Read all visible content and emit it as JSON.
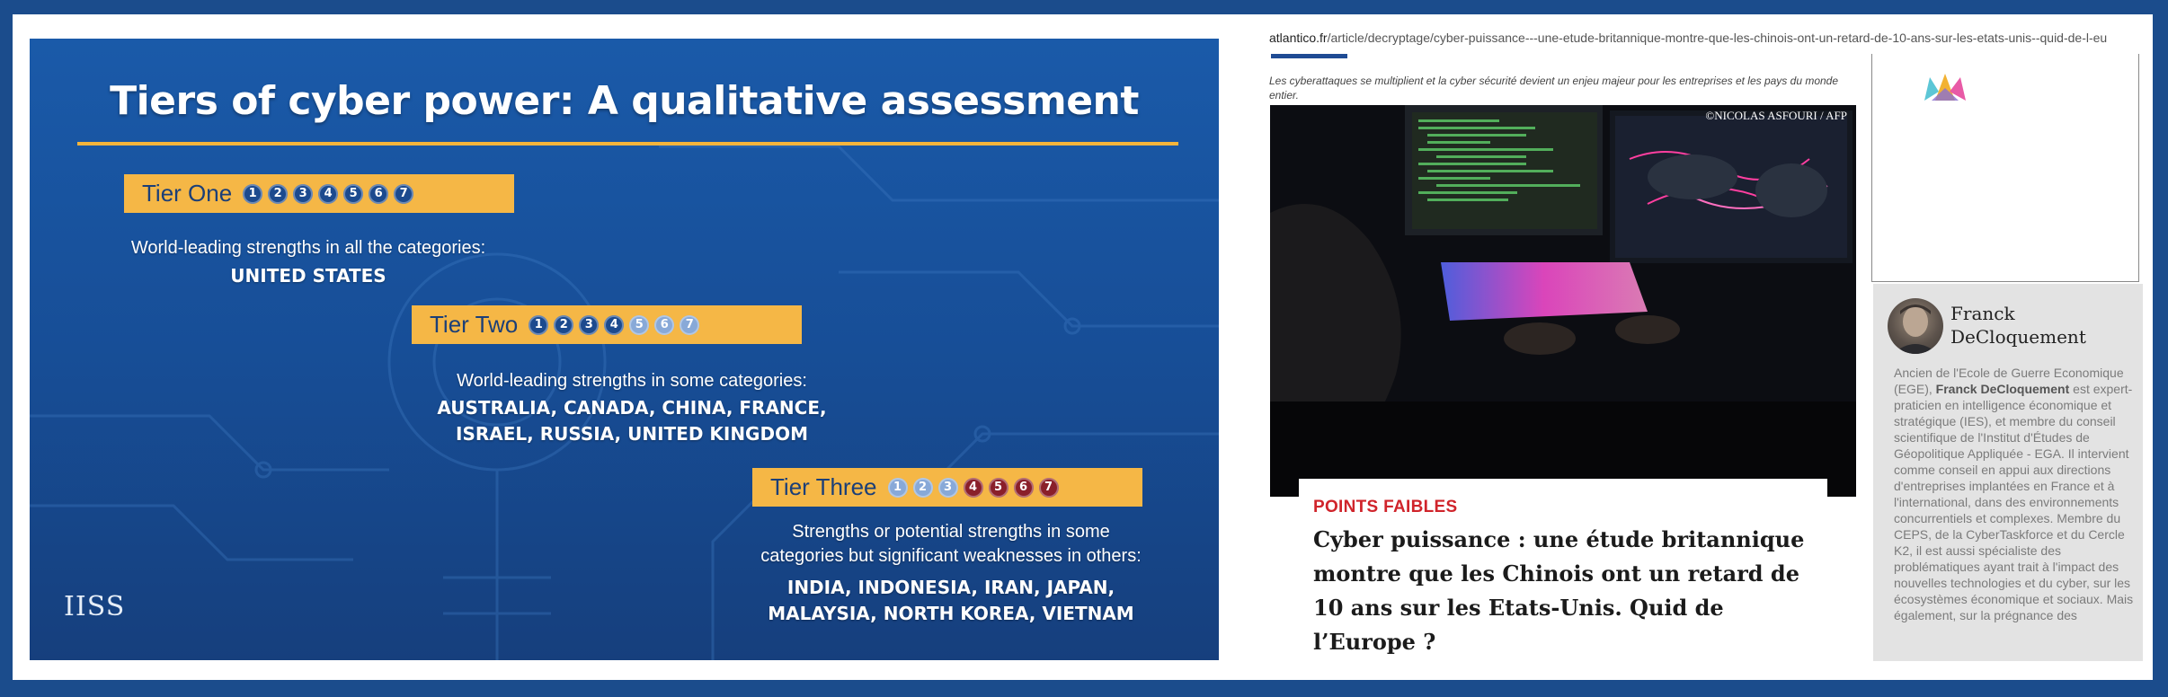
{
  "slide": {
    "title": "Tiers of cyber power: A qualitative assessment",
    "tiers": [
      {
        "label": "Tier One",
        "dots": [
          "1",
          "2",
          "3",
          "4",
          "5",
          "6",
          "7"
        ],
        "description": "World-leading strengths in all the categories:",
        "countries_line1": "UNITED STATES",
        "countries_line2": ""
      },
      {
        "label": "Tier Two",
        "dots": [
          "1",
          "2",
          "3",
          "4",
          "5",
          "6",
          "7"
        ],
        "description": "World-leading strengths in some categories:",
        "countries_line1": "AUSTRALIA, CANADA, CHINA, FRANCE,",
        "countries_line2": "ISRAEL, RUSSIA, UNITED KINGDOM"
      },
      {
        "label": "Tier Three",
        "dots": [
          "1",
          "2",
          "3",
          "4",
          "5",
          "6",
          "7"
        ],
        "description_line1": "Strengths or potential strengths in some",
        "description_line2": "categories but significant weaknesses in others:",
        "countries_line1": "INDIA, INDONESIA, IRAN, JAPAN,",
        "countries_line2": "MALAYSIA, NORTH KOREA, VIETNAM"
      }
    ],
    "colors": {
      "strength": "#1c4a8e",
      "partial": "#88a9d8",
      "weakness": "#8a1f2a",
      "tier_bar": "#f5b746"
    },
    "logo_text": "IISS"
  },
  "article": {
    "url_domain": "atlantico.fr",
    "url_path": "/article/decryptage/cyber-puissance---une-etude-britannique-montre-que-les-chinois-ont-un-retard-de-10-ans-sur-les-etats-unis--quid-de-l-eu",
    "caption": "Les cyberattaques se multiplient et la cyber sécurité devient un enjeu majeur pour les entreprises et les pays du monde entier.",
    "photo_credit": "©NICOLAS ASFOURI / AFP",
    "kicker": "POINTS FAIBLES",
    "headline": "Cyber puissance : une étude britannique montre que les Chinois ont un retard de 10 ans sur les Etats-Unis. Quid de l’Europe ?",
    "kicker_color": "#d0242b"
  },
  "author": {
    "name_line1": "Franck",
    "name_line2": "DeCloquement",
    "bio_intro": "Ancien de l'Ecole de Guerre Economique (EGE), ",
    "bio_name": "Franck DeCloquement",
    "bio_rest": " est expert-praticien en intelligence économique et stratégique (IES), et membre du conseil scientifique de l'Institut d'Études de Géopolitique Appliquée - EGA. Il intervient comme conseil en appui aux directions d'entreprises implantées en France et à l'international, dans des environnements concurrentiels et complexes. Membre du CEPS, de la CyberTaskforce et du Cercle K2, il est aussi spécialiste des problématiques ayant trait à l'impact des nouvelles technologies et du cyber, sur les écosystèmes économique et sociaux. Mais également, sur la prégnance des"
  }
}
